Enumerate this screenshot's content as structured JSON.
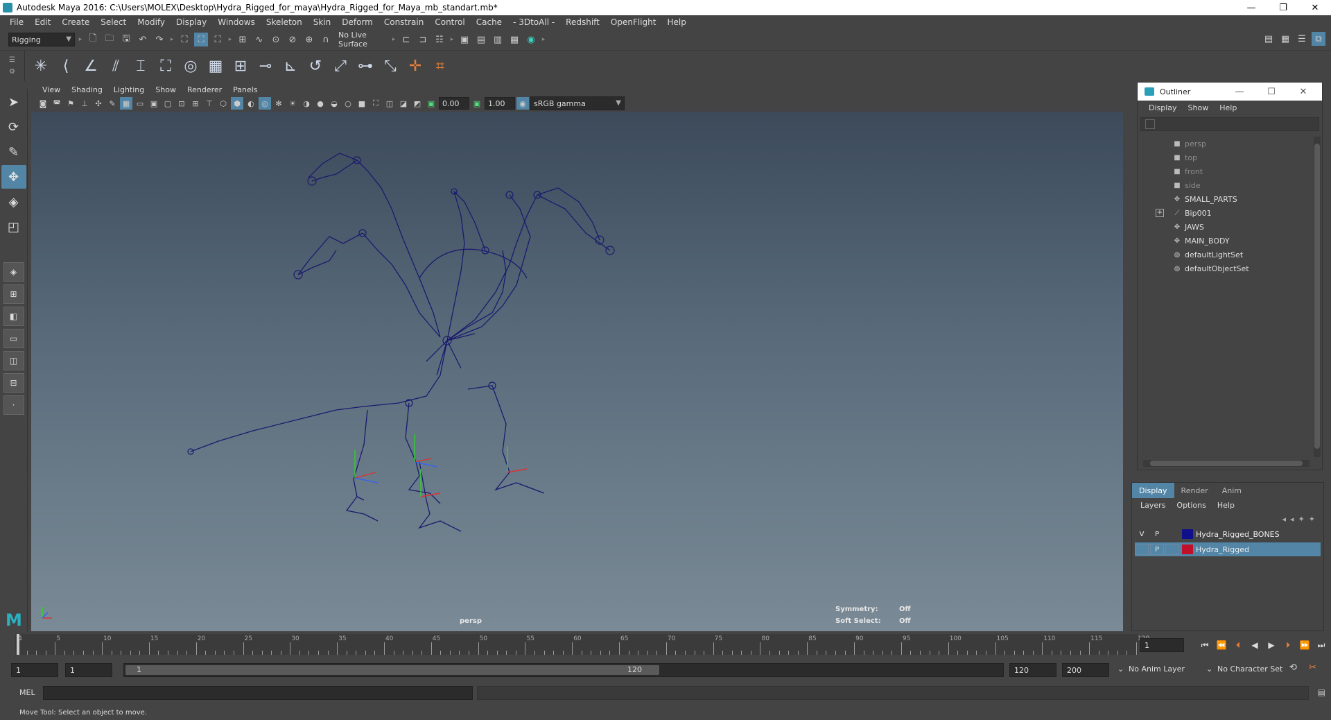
{
  "window": {
    "title": "Autodesk Maya 2016: C:\\Users\\MOLEX\\Desktop\\Hydra_Rigged_for_maya\\Hydra_Rigged_for_Maya_mb_standart.mb*",
    "minimize": "—",
    "restore": "❐",
    "close": "✕"
  },
  "menu": [
    "File",
    "Edit",
    "Create",
    "Select",
    "Modify",
    "Display",
    "Windows",
    "Skeleton",
    "Skin",
    "Deform",
    "Constrain",
    "Control",
    "Cache",
    "- 3DtoAll -",
    "Redshift",
    "OpenFlight",
    "Help"
  ],
  "statusline": {
    "menuset": "Rigging",
    "live_surface": "No Live Surface"
  },
  "panel": {
    "menu": [
      "View",
      "Shading",
      "Lighting",
      "Show",
      "Renderer",
      "Panels"
    ],
    "gamma_value_1": "0.00",
    "gamma_value_2": "1.00",
    "color_space": "sRGB gamma"
  },
  "viewport": {
    "camera": "persp",
    "symmetry_label": "Symmetry:",
    "symmetry_value": "Off",
    "softselect_label": "Soft Select:",
    "softselect_value": "Off",
    "axis_colors": {
      "x": "#e03030",
      "y": "#30d030",
      "z": "#3060ff"
    },
    "skeleton_color": "#1a1a6e"
  },
  "outliner": {
    "title": "Outliner",
    "menu": [
      "Display",
      "Show",
      "Help"
    ],
    "items": [
      {
        "label": "persp",
        "icon": "camera-icon",
        "dim": true
      },
      {
        "label": "top",
        "icon": "camera-icon",
        "dim": true
      },
      {
        "label": "front",
        "icon": "camera-icon",
        "dim": true
      },
      {
        "label": "side",
        "icon": "camera-icon",
        "dim": true
      },
      {
        "label": "SMALL_PARTS",
        "icon": "group-icon",
        "dim": false
      },
      {
        "label": "Bip001",
        "icon": "joint-icon",
        "dim": false,
        "expandable": true
      },
      {
        "label": "JAWS",
        "icon": "group-icon",
        "dim": false
      },
      {
        "label": "MAIN_BODY",
        "icon": "group-icon",
        "dim": false
      },
      {
        "label": "defaultLightSet",
        "icon": "set-icon",
        "dim": false
      },
      {
        "label": "defaultObjectSet",
        "icon": "set-icon",
        "dim": false
      }
    ]
  },
  "layers": {
    "tabs": [
      "Display",
      "Render",
      "Anim"
    ],
    "menu": [
      "Layers",
      "Options",
      "Help"
    ],
    "rows": [
      {
        "v": "V",
        "p": "P",
        "name": "Hydra_Rigged_BONES",
        "color": "#10108a",
        "selected": false
      },
      {
        "v": "",
        "p": "P",
        "name": "Hydra_Rigged",
        "color": "#c0102a",
        "selected": true
      }
    ]
  },
  "timeline": {
    "ticks": [
      "1",
      "5",
      "10",
      "15",
      "20",
      "25",
      "30",
      "35",
      "40",
      "45",
      "50",
      "55",
      "60",
      "65",
      "70",
      "75",
      "80",
      "85",
      "90",
      "95",
      "100",
      "105",
      "110",
      "115",
      "120"
    ],
    "current_frame": "1"
  },
  "range": {
    "start": "1",
    "playback_start": "1",
    "slider_start": "1",
    "slider_end": "120",
    "playback_end": "120",
    "end": "200",
    "anim_layer": "No Anim Layer",
    "character_set": "No Character Set"
  },
  "command": {
    "language": "MEL"
  },
  "help": "Move Tool: Select an object to move."
}
